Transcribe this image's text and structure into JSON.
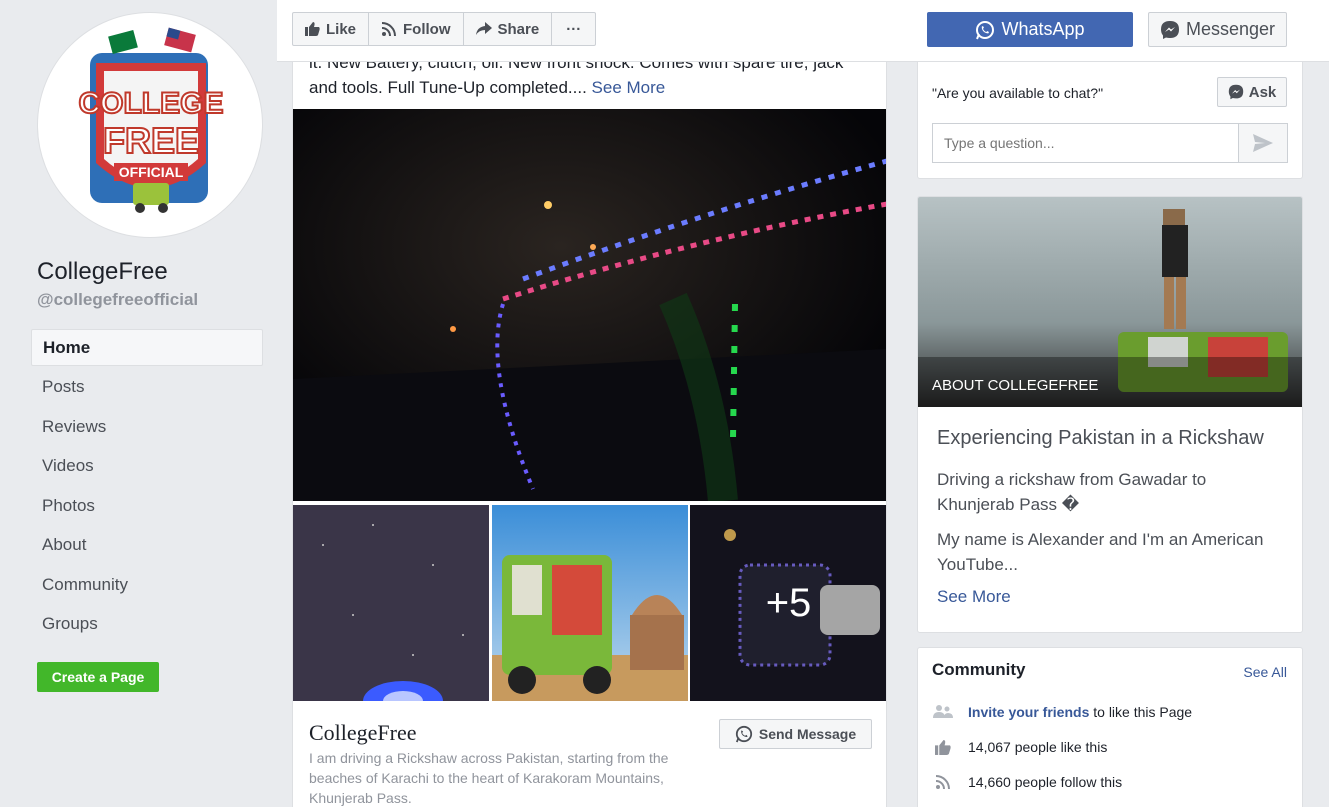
{
  "sidebar": {
    "page_name": "CollegeFree",
    "handle": "@collegefreeofficial",
    "logo_text": [
      "COLLEGE",
      "FREE",
      "OFFICIAL"
    ],
    "nav": [
      "Home",
      "Posts",
      "Reviews",
      "Videos",
      "Photos",
      "About",
      "Community",
      "Groups"
    ],
    "active_nav": "Home",
    "create_page": "Create a Page"
  },
  "topbar": {
    "like": "Like",
    "follow": "Follow",
    "share": "Share",
    "more": "···",
    "whatsapp": "WhatsApp",
    "messenger": "Messenger",
    "brand_color": "#4267b2"
  },
  "post": {
    "text_line1": "it. New Battery, clutch, oil. New front shock. Comes with spare tire, jack",
    "text_line2": "and tools. Full Tune-Up completed....",
    "see_more": "See More",
    "more_photos": "+5"
  },
  "card": {
    "title": "CollegeFree",
    "description": "I am driving a Rickshaw across Pakistan, starting from the beaches of Karachi to the heart of Karakoram Mountains, Khunjerab Pass.",
    "send_message": "Send Message"
  },
  "chat": {
    "question": "\"Are you available to chat?\"",
    "ask": "Ask",
    "input_placeholder": "Type a question..."
  },
  "about": {
    "label": "ABOUT COLLEGEFREE",
    "title": "Experiencing Pakistan in a Rickshaw",
    "p1": "Driving a rickshaw from Gawadar to Khunjerab Pass �",
    "p2": "My name is Alexander and I'm an American YouTube...",
    "see_more": "See More"
  },
  "community": {
    "title": "Community",
    "see_all": "See All",
    "invite_link": "Invite your friends",
    "invite_rest": " to like this Page",
    "likes": "14,067 people like this",
    "follows": "14,660 people follow this"
  }
}
